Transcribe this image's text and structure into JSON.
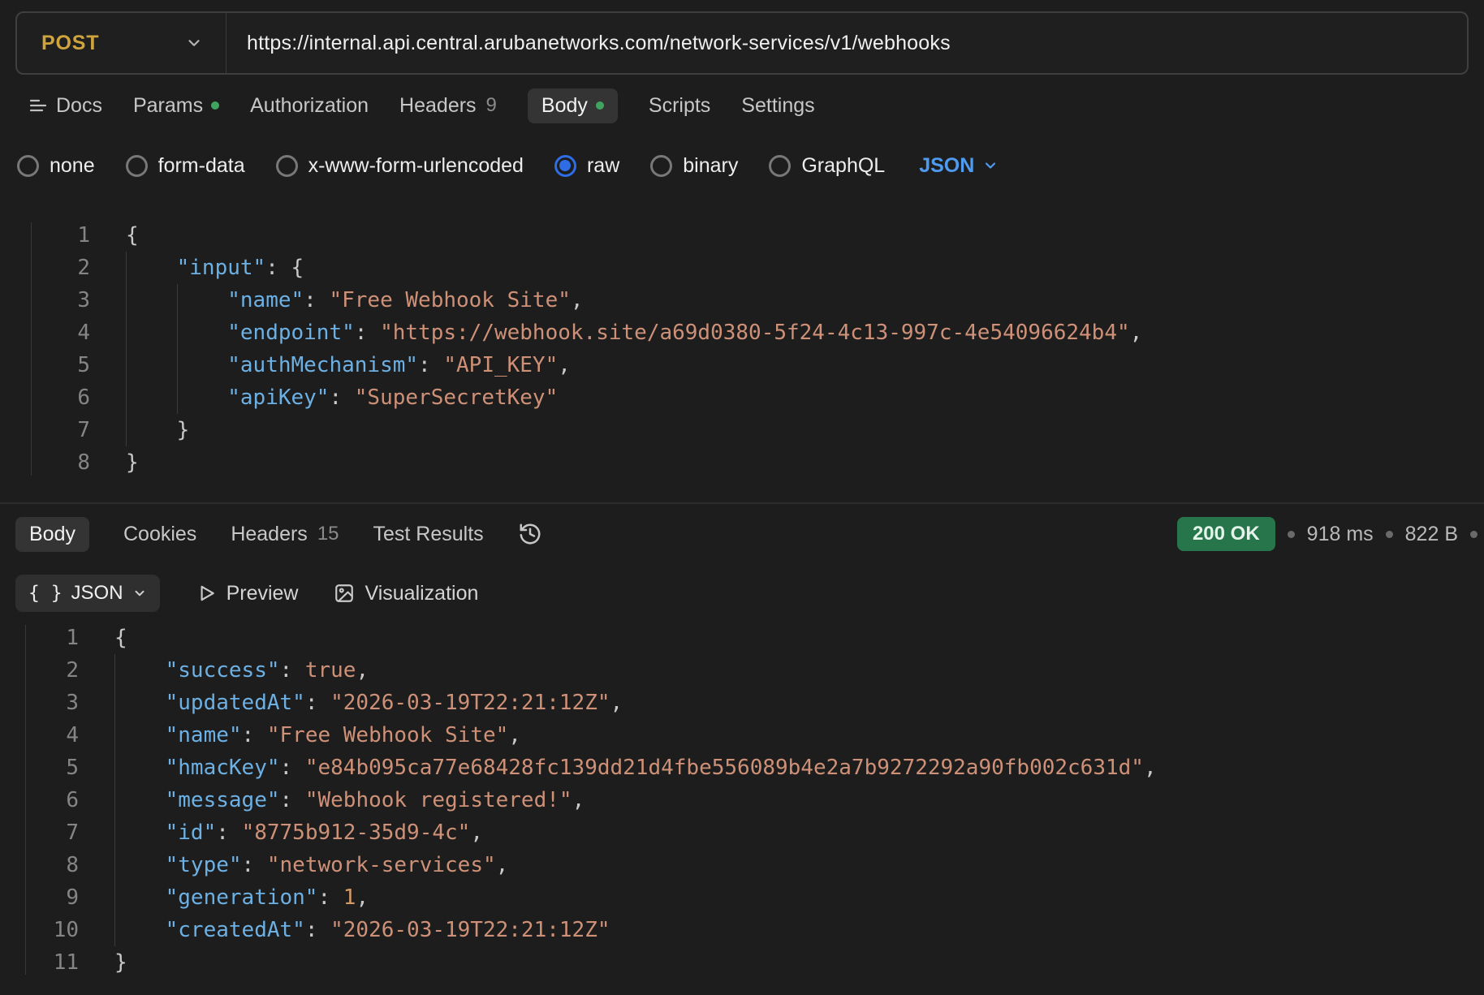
{
  "colors": {
    "method-post": "#cfa43c",
    "accent-blue": "#4e9bef",
    "radio-blue": "#2e6de6",
    "dot-green": "#3fa45f",
    "status-green-bg": "#27764b",
    "key-blue": "#6cb0e4",
    "string-orange": "#ce9178",
    "number-orange": "#d19a66"
  },
  "request": {
    "method": "POST",
    "url": "https://internal.api.central.arubanetworks.com/network-services/v1/webhooks",
    "docs_label": "Docs",
    "tabs": [
      {
        "label": "Params",
        "modified": true
      },
      {
        "label": "Authorization"
      },
      {
        "label": "Headers",
        "count": "9"
      },
      {
        "label": "Body",
        "modified": true,
        "active": true
      },
      {
        "label": "Scripts"
      },
      {
        "label": "Settings"
      }
    ],
    "body_types": [
      {
        "label": "none"
      },
      {
        "label": "form-data"
      },
      {
        "label": "x-www-form-urlencoded"
      },
      {
        "label": "raw",
        "selected": true
      },
      {
        "label": "binary"
      },
      {
        "label": "GraphQL"
      }
    ],
    "raw_format": "JSON"
  },
  "request_editor": {
    "lines": [
      [
        [
          "p",
          "{"
        ]
      ],
      [
        [
          "w",
          "    "
        ],
        [
          "k",
          "\"input\""
        ],
        [
          "p",
          ": {"
        ]
      ],
      [
        [
          "w",
          "        "
        ],
        [
          "k",
          "\"name\""
        ],
        [
          "p",
          ": "
        ],
        [
          "s",
          "\"Free Webhook Site\""
        ],
        [
          "p",
          ","
        ]
      ],
      [
        [
          "w",
          "        "
        ],
        [
          "k",
          "\"endpoint\""
        ],
        [
          "p",
          ": "
        ],
        [
          "s",
          "\"https://webhook.site/a69d0380-5f24-4c13-997c-4e54096624b4\""
        ],
        [
          "p",
          ","
        ]
      ],
      [
        [
          "w",
          "        "
        ],
        [
          "k",
          "\"authMechanism\""
        ],
        [
          "p",
          ": "
        ],
        [
          "s",
          "\"API_KEY\""
        ],
        [
          "p",
          ","
        ]
      ],
      [
        [
          "w",
          "        "
        ],
        [
          "k",
          "\"apiKey\""
        ],
        [
          "p",
          ": "
        ],
        [
          "s",
          "\"SuperSecretKey\""
        ]
      ],
      [
        [
          "w",
          "    "
        ],
        [
          "p",
          "}"
        ]
      ],
      [
        [
          "p",
          "}"
        ]
      ]
    ]
  },
  "response": {
    "tabs": [
      {
        "label": "Body",
        "active": true
      },
      {
        "label": "Cookies"
      },
      {
        "label": "Headers",
        "count": "15"
      },
      {
        "label": "Test Results"
      }
    ],
    "status": "200 OK",
    "time": "918 ms",
    "size": "822 B",
    "format_glyph": "{ }",
    "format_label": "JSON",
    "preview_label": "Preview",
    "visualization_label": "Visualization"
  },
  "response_editor": {
    "lines": [
      [
        [
          "p",
          "{"
        ]
      ],
      [
        [
          "w",
          "    "
        ],
        [
          "k",
          "\"success\""
        ],
        [
          "p",
          ": "
        ],
        [
          "b",
          "true"
        ],
        [
          "p",
          ","
        ]
      ],
      [
        [
          "w",
          "    "
        ],
        [
          "k",
          "\"updatedAt\""
        ],
        [
          "p",
          ": "
        ],
        [
          "s",
          "\"2026-03-19T22:21:12Z\""
        ],
        [
          "p",
          ","
        ]
      ],
      [
        [
          "w",
          "    "
        ],
        [
          "k",
          "\"name\""
        ],
        [
          "p",
          ": "
        ],
        [
          "s",
          "\"Free Webhook Site\""
        ],
        [
          "p",
          ","
        ]
      ],
      [
        [
          "w",
          "    "
        ],
        [
          "k",
          "\"hmacKey\""
        ],
        [
          "p",
          ": "
        ],
        [
          "s",
          "\"e84b095ca77e68428fc139dd21d4fbe556089b4e2a7b9272292a90fb002c631d\""
        ],
        [
          "p",
          ","
        ]
      ],
      [
        [
          "w",
          "    "
        ],
        [
          "k",
          "\"message\""
        ],
        [
          "p",
          ": "
        ],
        [
          "s",
          "\"Webhook registered!\""
        ],
        [
          "p",
          ","
        ]
      ],
      [
        [
          "w",
          "    "
        ],
        [
          "k",
          "\"id\""
        ],
        [
          "p",
          ": "
        ],
        [
          "s",
          "\"8775b912-35d9-4c\""
        ],
        [
          "p",
          ","
        ]
      ],
      [
        [
          "w",
          "    "
        ],
        [
          "k",
          "\"type\""
        ],
        [
          "p",
          ": "
        ],
        [
          "s",
          "\"network-services\""
        ],
        [
          "p",
          ","
        ]
      ],
      [
        [
          "w",
          "    "
        ],
        [
          "k",
          "\"generation\""
        ],
        [
          "p",
          ": "
        ],
        [
          "n",
          "1"
        ],
        [
          "p",
          ","
        ]
      ],
      [
        [
          "w",
          "    "
        ],
        [
          "k",
          "\"createdAt\""
        ],
        [
          "p",
          ": "
        ],
        [
          "s",
          "\"2026-03-19T22:21:12Z\""
        ]
      ],
      [
        [
          "p",
          "}"
        ]
      ]
    ]
  }
}
